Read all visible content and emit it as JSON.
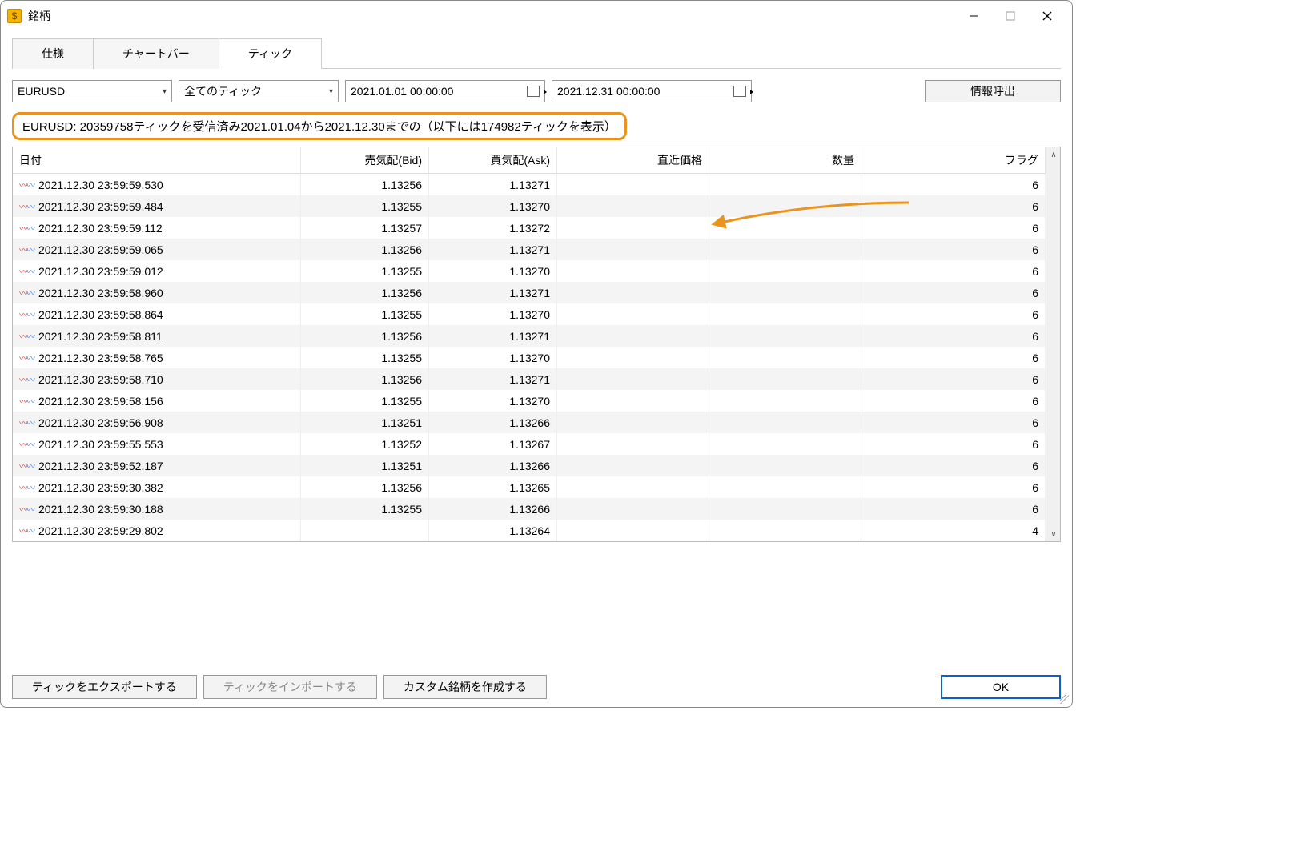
{
  "window": {
    "title": "銘柄"
  },
  "tabs": [
    {
      "label": "仕様",
      "active": false
    },
    {
      "label": "チャートバー",
      "active": false
    },
    {
      "label": "ティック",
      "active": true
    }
  ],
  "filters": {
    "symbol": "EURUSD",
    "tick_type": "全てのティック",
    "date_from": "2021.01.01 00:00:00",
    "date_to": "2021.12.31 00:00:00",
    "info_btn": "情報呼出"
  },
  "status_text": "EURUSD: 20359758ティックを受信済み2021.01.04から2021.12.30までの（以下には174982ティックを表示）",
  "columns": {
    "date": "日付",
    "bid": "売気配(Bid)",
    "ask": "買気配(Ask)",
    "last": "直近価格",
    "volume": "数量",
    "flag": "フラグ"
  },
  "rows": [
    {
      "date": "2021.12.30 23:59:59.530",
      "bid": "1.13256",
      "ask": "1.13271",
      "last": "",
      "vol": "",
      "flag": "6"
    },
    {
      "date": "2021.12.30 23:59:59.484",
      "bid": "1.13255",
      "ask": "1.13270",
      "last": "",
      "vol": "",
      "flag": "6"
    },
    {
      "date": "2021.12.30 23:59:59.112",
      "bid": "1.13257",
      "ask": "1.13272",
      "last": "",
      "vol": "",
      "flag": "6"
    },
    {
      "date": "2021.12.30 23:59:59.065",
      "bid": "1.13256",
      "ask": "1.13271",
      "last": "",
      "vol": "",
      "flag": "6"
    },
    {
      "date": "2021.12.30 23:59:59.012",
      "bid": "1.13255",
      "ask": "1.13270",
      "last": "",
      "vol": "",
      "flag": "6"
    },
    {
      "date": "2021.12.30 23:59:58.960",
      "bid": "1.13256",
      "ask": "1.13271",
      "last": "",
      "vol": "",
      "flag": "6"
    },
    {
      "date": "2021.12.30 23:59:58.864",
      "bid": "1.13255",
      "ask": "1.13270",
      "last": "",
      "vol": "",
      "flag": "6"
    },
    {
      "date": "2021.12.30 23:59:58.811",
      "bid": "1.13256",
      "ask": "1.13271",
      "last": "",
      "vol": "",
      "flag": "6"
    },
    {
      "date": "2021.12.30 23:59:58.765",
      "bid": "1.13255",
      "ask": "1.13270",
      "last": "",
      "vol": "",
      "flag": "6"
    },
    {
      "date": "2021.12.30 23:59:58.710",
      "bid": "1.13256",
      "ask": "1.13271",
      "last": "",
      "vol": "",
      "flag": "6"
    },
    {
      "date": "2021.12.30 23:59:58.156",
      "bid": "1.13255",
      "ask": "1.13270",
      "last": "",
      "vol": "",
      "flag": "6"
    },
    {
      "date": "2021.12.30 23:59:56.908",
      "bid": "1.13251",
      "ask": "1.13266",
      "last": "",
      "vol": "",
      "flag": "6"
    },
    {
      "date": "2021.12.30 23:59:55.553",
      "bid": "1.13252",
      "ask": "1.13267",
      "last": "",
      "vol": "",
      "flag": "6"
    },
    {
      "date": "2021.12.30 23:59:52.187",
      "bid": "1.13251",
      "ask": "1.13266",
      "last": "",
      "vol": "",
      "flag": "6"
    },
    {
      "date": "2021.12.30 23:59:30.382",
      "bid": "1.13256",
      "ask": "1.13265",
      "last": "",
      "vol": "",
      "flag": "6"
    },
    {
      "date": "2021.12.30 23:59:30.188",
      "bid": "1.13255",
      "ask": "1.13266",
      "last": "",
      "vol": "",
      "flag": "6"
    },
    {
      "date": "2021.12.30 23:59:29.802",
      "bid": "",
      "ask": "1.13264",
      "last": "",
      "vol": "",
      "flag": "4"
    }
  ],
  "footer": {
    "export": "ティックをエクスポートする",
    "import": "ティックをインポートする",
    "custom": "カスタム銘柄を作成する",
    "ok": "OK"
  }
}
